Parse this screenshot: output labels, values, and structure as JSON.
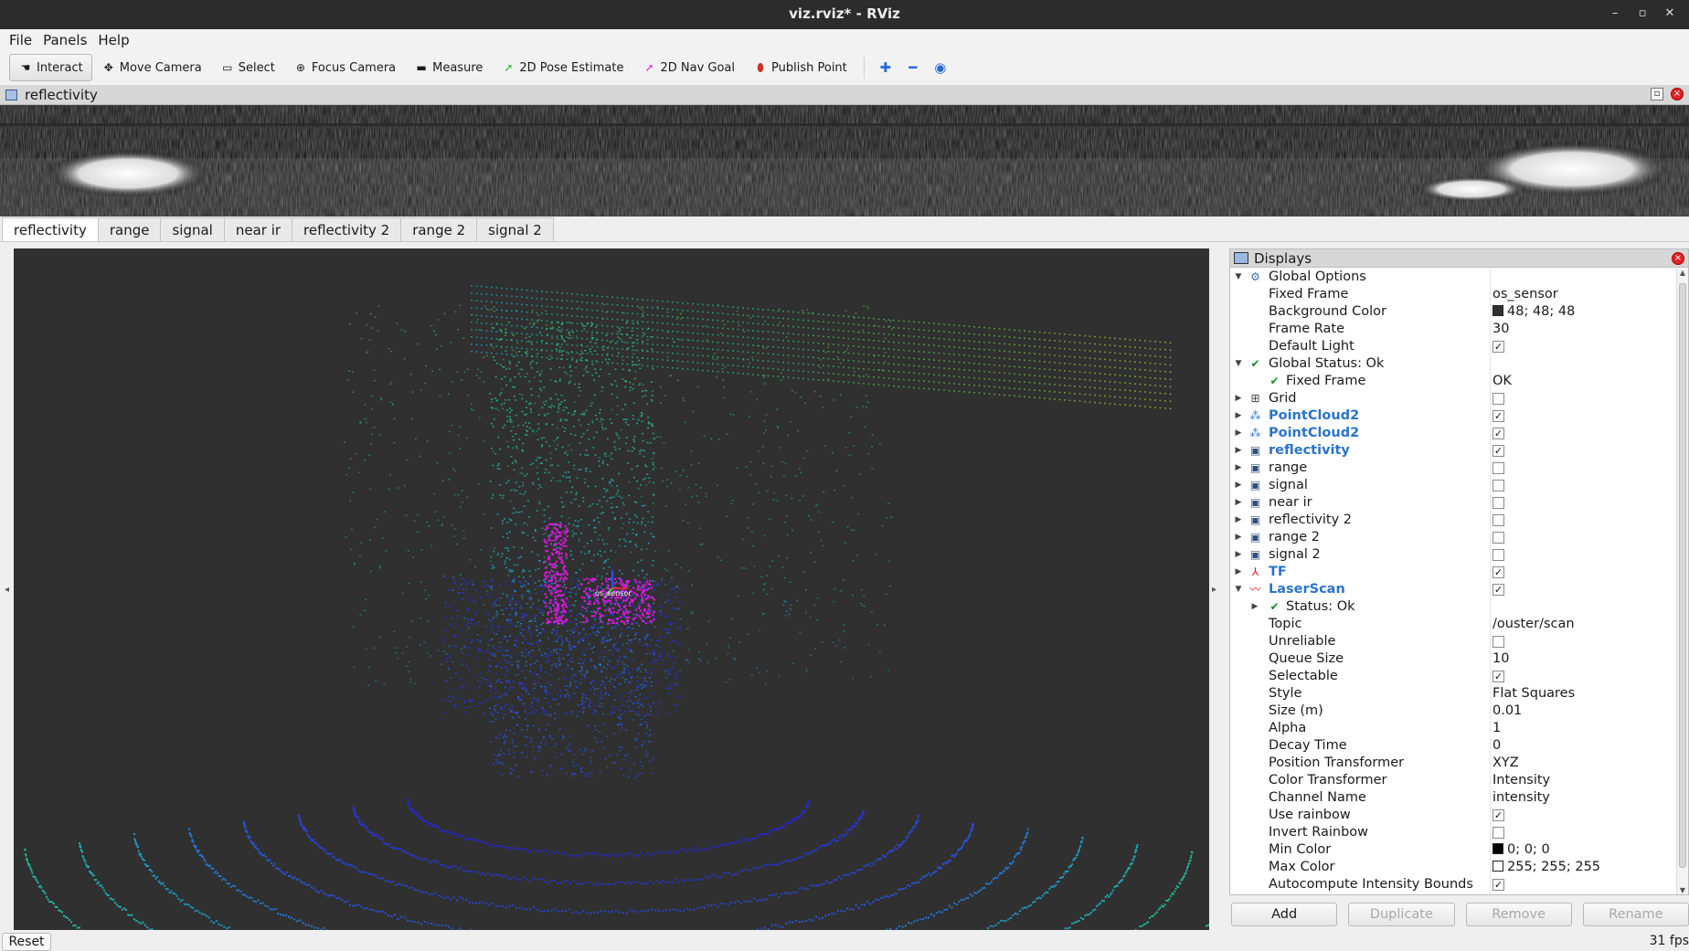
{
  "window": {
    "title": "viz.rviz* - RViz"
  },
  "menu": [
    "File",
    "Panels",
    "Help"
  ],
  "toolbar": {
    "tools": [
      {
        "label": "Interact",
        "icon": "hand-icon",
        "active": true
      },
      {
        "label": "Move Camera",
        "icon": "move-camera-icon"
      },
      {
        "label": "Select",
        "icon": "select-icon"
      },
      {
        "label": "Focus Camera",
        "icon": "focus-camera-icon"
      },
      {
        "label": "Measure",
        "icon": "ruler-icon"
      },
      {
        "label": "2D Pose Estimate",
        "icon": "pose-arrow-icon",
        "color": "#22bb22"
      },
      {
        "label": "2D Nav Goal",
        "icon": "nav-goal-arrow-icon",
        "color": "#d22bd2"
      },
      {
        "label": "Publish Point",
        "icon": "map-pin-icon",
        "color": "#cc3322"
      }
    ]
  },
  "image_panel": {
    "title": "reflectivity"
  },
  "tabs": [
    "reflectivity",
    "range",
    "signal",
    "near ir",
    "reflectivity 2",
    "range 2",
    "signal 2"
  ],
  "viewport": {
    "frame_label": "os_sensor",
    "background": "#303030"
  },
  "displays": {
    "title": "Displays",
    "rows": [
      {
        "label": "Global Options",
        "arrow": "down",
        "indent": 0,
        "icon": "gear-icon"
      },
      {
        "label": "Fixed Frame",
        "indent": 1,
        "value": "os_sensor"
      },
      {
        "label": "Background Color",
        "indent": 1,
        "value": "48; 48; 48",
        "swatch": "#303030"
      },
      {
        "label": "Frame Rate",
        "indent": 1,
        "value": "30"
      },
      {
        "label": "Default Light",
        "indent": 1,
        "check": true
      },
      {
        "label": "Global Status: Ok",
        "arrow": "down",
        "indent": 0,
        "icon": "checkmark-icon"
      },
      {
        "label": "Fixed Frame",
        "indent": 1,
        "icon": "checkmark-icon",
        "value": "OK"
      },
      {
        "label": "Grid",
        "arrow": "right",
        "indent": 0,
        "icon": "grid-icon",
        "check": false
      },
      {
        "label": "PointCloud2",
        "arrow": "right",
        "indent": 0,
        "icon": "pointcloud-icon",
        "check": true,
        "highlight": true
      },
      {
        "label": "PointCloud2",
        "arrow": "right",
        "indent": 0,
        "icon": "pointcloud-icon",
        "check": true,
        "highlight": true
      },
      {
        "label": "reflectivity",
        "arrow": "right",
        "indent": 0,
        "icon": "image-icon",
        "check": true,
        "highlight": true
      },
      {
        "label": "range",
        "arrow": "right",
        "indent": 0,
        "icon": "image-icon",
        "check": false
      },
      {
        "label": "signal",
        "arrow": "right",
        "indent": 0,
        "icon": "image-icon",
        "check": false
      },
      {
        "label": "near ir",
        "arrow": "right",
        "indent": 0,
        "icon": "image-icon",
        "check": false
      },
      {
        "label": "reflectivity 2",
        "arrow": "right",
        "indent": 0,
        "icon": "image-icon",
        "check": false
      },
      {
        "label": "range 2",
        "arrow": "right",
        "indent": 0,
        "icon": "image-icon",
        "check": false
      },
      {
        "label": "signal 2",
        "arrow": "right",
        "indent": 0,
        "icon": "image-icon",
        "check": false
      },
      {
        "label": "TF",
        "arrow": "right",
        "indent": 0,
        "icon": "tf-icon",
        "check": true,
        "highlight": true
      },
      {
        "label": "LaserScan",
        "arrow": "down",
        "indent": 0,
        "icon": "laserscan-icon",
        "check": true,
        "highlight": true
      },
      {
        "label": "Status: Ok",
        "arrow": "right",
        "indent": 1,
        "icon": "checkmark-icon"
      },
      {
        "label": "Topic",
        "indent": 1,
        "value": "/ouster/scan"
      },
      {
        "label": "Unreliable",
        "indent": 1,
        "check": false
      },
      {
        "label": "Queue Size",
        "indent": 1,
        "value": "10"
      },
      {
        "label": "Selectable",
        "indent": 1,
        "check": true
      },
      {
        "label": "Style",
        "indent": 1,
        "value": "Flat Squares"
      },
      {
        "label": "Size (m)",
        "indent": 1,
        "value": "0.01"
      },
      {
        "label": "Alpha",
        "indent": 1,
        "value": "1"
      },
      {
        "label": "Decay Time",
        "indent": 1,
        "value": "0"
      },
      {
        "label": "Position Transformer",
        "indent": 1,
        "value": "XYZ"
      },
      {
        "label": "Color Transformer",
        "indent": 1,
        "value": "Intensity"
      },
      {
        "label": "Channel Name",
        "indent": 1,
        "value": "intensity"
      },
      {
        "label": "Use rainbow",
        "indent": 1,
        "check": true
      },
      {
        "label": "Invert Rainbow",
        "indent": 1,
        "check": false
      },
      {
        "label": "Min Color",
        "indent": 1,
        "value": "0; 0; 0",
        "swatch": "#000000"
      },
      {
        "label": "Max Color",
        "indent": 1,
        "value": "255; 255; 255",
        "swatch": "#ffffff"
      },
      {
        "label": "Autocompute Intensity Bounds",
        "indent": 1,
        "check": true
      }
    ],
    "buttons": [
      {
        "label": "Add",
        "enabled": true
      },
      {
        "label": "Duplicate",
        "enabled": false
      },
      {
        "label": "Remove",
        "enabled": false
      },
      {
        "label": "Rename",
        "enabled": false
      }
    ]
  },
  "status": {
    "reset_label": "Reset",
    "fps": "31 fps"
  }
}
